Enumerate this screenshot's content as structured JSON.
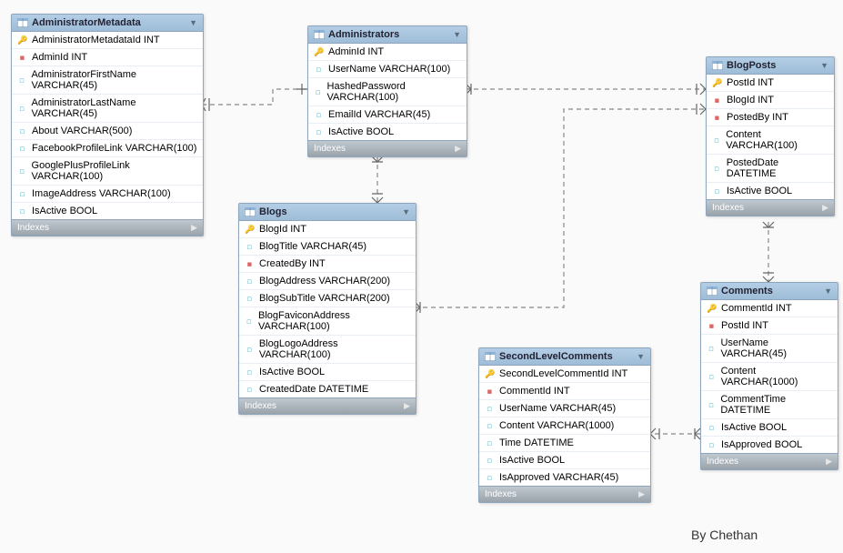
{
  "tables": {
    "administratorMetadata": {
      "name": "AdministratorMetadata",
      "footer": "Indexes",
      "columns": [
        {
          "key": "pk",
          "label": "AdministratorMetadataId INT"
        },
        {
          "key": "fk",
          "label": "AdminId INT"
        },
        {
          "key": "col",
          "label": "AdministratorFirstName VARCHAR(45)"
        },
        {
          "key": "col",
          "label": "AdministratorLastName VARCHAR(45)"
        },
        {
          "key": "col",
          "label": "About VARCHAR(500)"
        },
        {
          "key": "col",
          "label": "FacebookProfileLink VARCHAR(100)"
        },
        {
          "key": "col",
          "label": "GooglePlusProfileLink VARCHAR(100)"
        },
        {
          "key": "col",
          "label": "ImageAddress VARCHAR(100)"
        },
        {
          "key": "col",
          "label": "IsActive BOOL"
        }
      ]
    },
    "administrators": {
      "name": "Administrators",
      "footer": "Indexes",
      "columns": [
        {
          "key": "pk",
          "label": "AdminId INT"
        },
        {
          "key": "col",
          "label": "UserName VARCHAR(100)"
        },
        {
          "key": "col",
          "label": "HashedPassword VARCHAR(100)"
        },
        {
          "key": "col",
          "label": "EmailId VARCHAR(45)"
        },
        {
          "key": "col",
          "label": "IsActive BOOL"
        }
      ]
    },
    "blogs": {
      "name": "Blogs",
      "footer": "Indexes",
      "columns": [
        {
          "key": "pk",
          "label": "BlogId INT"
        },
        {
          "key": "col",
          "label": "BlogTitle VARCHAR(45)"
        },
        {
          "key": "fk",
          "label": "CreatedBy INT"
        },
        {
          "key": "col",
          "label": "BlogAddress VARCHAR(200)"
        },
        {
          "key": "col",
          "label": "BlogSubTitle VARCHAR(200)"
        },
        {
          "key": "col",
          "label": "BlogFaviconAddress VARCHAR(100)"
        },
        {
          "key": "col",
          "label": "BlogLogoAddress VARCHAR(100)"
        },
        {
          "key": "col",
          "label": "IsActive BOOL"
        },
        {
          "key": "col",
          "label": "CreatedDate DATETIME"
        }
      ]
    },
    "blogPosts": {
      "name": "BlogPosts",
      "footer": "Indexes",
      "columns": [
        {
          "key": "pk",
          "label": "PostId INT"
        },
        {
          "key": "fk",
          "label": "BlogId INT"
        },
        {
          "key": "fk",
          "label": "PostedBy INT"
        },
        {
          "key": "col",
          "label": "Content VARCHAR(100)"
        },
        {
          "key": "col",
          "label": "PostedDate DATETIME"
        },
        {
          "key": "col",
          "label": "IsActive BOOL"
        }
      ]
    },
    "comments": {
      "name": "Comments",
      "footer": "Indexes",
      "columns": [
        {
          "key": "pk",
          "label": "CommentId INT"
        },
        {
          "key": "fk",
          "label": "PostId INT"
        },
        {
          "key": "col",
          "label": "UserName VARCHAR(45)"
        },
        {
          "key": "col",
          "label": "Content VARCHAR(1000)"
        },
        {
          "key": "col",
          "label": "CommentTime DATETIME"
        },
        {
          "key": "col",
          "label": "IsActive BOOL"
        },
        {
          "key": "col",
          "label": "IsApproved BOOL"
        }
      ]
    },
    "secondLevelComments": {
      "name": "SecondLevelComments",
      "footer": "Indexes",
      "columns": [
        {
          "key": "pk",
          "label": "SecondLevelCommentId INT"
        },
        {
          "key": "fk",
          "label": "CommentId INT"
        },
        {
          "key": "col",
          "label": "UserName VARCHAR(45)"
        },
        {
          "key": "col",
          "label": "Content VARCHAR(1000)"
        },
        {
          "key": "col",
          "label": "Time DATETIME"
        },
        {
          "key": "col",
          "label": "IsActive BOOL"
        },
        {
          "key": "col",
          "label": "IsApproved VARCHAR(45)"
        }
      ]
    }
  },
  "credit": "By Chethan"
}
